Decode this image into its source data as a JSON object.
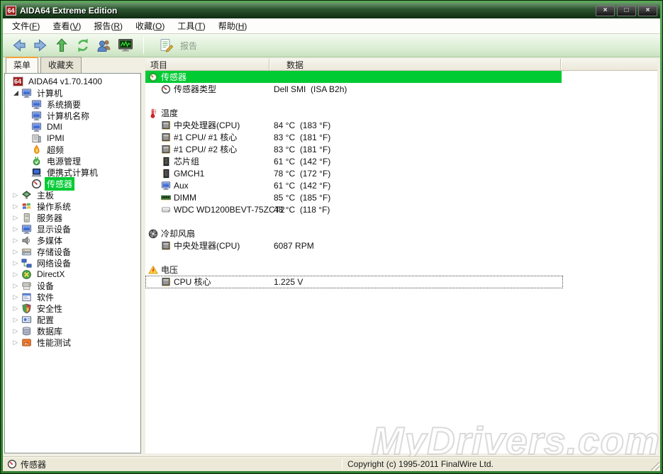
{
  "window": {
    "title": "AIDA64 Extreme Edition",
    "logo_text": "64",
    "buttons": [
      {
        "name": "minimize",
        "glyph": "×"
      },
      {
        "name": "maximize",
        "glyph": "□"
      },
      {
        "name": "close",
        "glyph": "×"
      }
    ]
  },
  "menu": {
    "items": [
      "文件(F)",
      "查看(V)",
      "报告(R)",
      "收藏(O)",
      "工具(T)",
      "帮助(H)"
    ]
  },
  "toolbar": {
    "buttons": [
      {
        "name": "back",
        "icon": "back"
      },
      {
        "name": "forward",
        "icon": "forward"
      },
      {
        "name": "up",
        "icon": "up"
      },
      {
        "name": "refresh",
        "icon": "refresh"
      },
      {
        "name": "users",
        "icon": "users"
      },
      {
        "name": "sensor-panel",
        "icon": "monitorgraph"
      }
    ],
    "report_label": "报告"
  },
  "sidebar": {
    "tabs": [
      {
        "label": "菜单",
        "active": true
      },
      {
        "label": "收藏夹",
        "active": false
      }
    ],
    "tree": [
      {
        "level": 0,
        "arrow": "",
        "icon": "aida64",
        "label": "AIDA64 v1.70.1400"
      },
      {
        "level": 0,
        "arrow": "expanded",
        "icon": "computer",
        "label": "计算机"
      },
      {
        "level": 1,
        "arrow": "",
        "icon": "computer",
        "label": "系统摘要"
      },
      {
        "level": 1,
        "arrow": "",
        "icon": "computer",
        "label": "计算机名称"
      },
      {
        "level": 1,
        "arrow": "",
        "icon": "computer",
        "label": "DMI"
      },
      {
        "level": 1,
        "arrow": "",
        "icon": "board",
        "label": "IPMI"
      },
      {
        "level": 1,
        "arrow": "",
        "icon": "flame",
        "label": "超频"
      },
      {
        "level": 1,
        "arrow": "",
        "icon": "plug",
        "label": "电源管理"
      },
      {
        "level": 1,
        "arrow": "",
        "icon": "laptop",
        "label": "便携式计算机"
      },
      {
        "level": 1,
        "arrow": "",
        "icon": "gauge",
        "label": "传感器",
        "selected": true
      },
      {
        "level": 0,
        "arrow": "collapsed",
        "icon": "motherboard",
        "label": "主板"
      },
      {
        "level": 0,
        "arrow": "collapsed",
        "icon": "windows",
        "label": "操作系统"
      },
      {
        "level": 0,
        "arrow": "collapsed",
        "icon": "server",
        "label": "服务器"
      },
      {
        "level": 0,
        "arrow": "collapsed",
        "icon": "display",
        "label": "显示设备"
      },
      {
        "level": 0,
        "arrow": "collapsed",
        "icon": "speaker",
        "label": "多媒体"
      },
      {
        "level": 0,
        "arrow": "collapsed",
        "icon": "storage",
        "label": "存储设备"
      },
      {
        "level": 0,
        "arrow": "collapsed",
        "icon": "network",
        "label": "网络设备"
      },
      {
        "level": 0,
        "arrow": "collapsed",
        "icon": "directx",
        "label": "DirectX"
      },
      {
        "level": 0,
        "arrow": "collapsed",
        "icon": "devices",
        "label": "设备"
      },
      {
        "level": 0,
        "arrow": "collapsed",
        "icon": "software",
        "label": "软件"
      },
      {
        "level": 0,
        "arrow": "collapsed",
        "icon": "shield",
        "label": "安全性"
      },
      {
        "level": 0,
        "arrow": "collapsed",
        "icon": "config",
        "label": "配置"
      },
      {
        "level": 0,
        "arrow": "collapsed",
        "icon": "database",
        "label": "数据库"
      },
      {
        "level": 0,
        "arrow": "collapsed",
        "icon": "benchmark",
        "label": "性能测试"
      }
    ]
  },
  "main": {
    "columns": [
      "项目",
      "数据"
    ],
    "rows": [
      {
        "type": "group",
        "icon": "gaugegreen",
        "label": "传感器"
      },
      {
        "type": "item",
        "icon": "gauge",
        "label": "传感器类型",
        "value": "Dell SMI  (ISA B2h)"
      },
      {
        "type": "spacer"
      },
      {
        "type": "section",
        "icon": "thermometer",
        "label": "温度"
      },
      {
        "type": "item",
        "icon": "chip",
        "label": "中央处理器(CPU)",
        "value": "84 °C  (183 °F)"
      },
      {
        "type": "item",
        "icon": "chip",
        "label": "#1 CPU/ #1 核心",
        "value": "83 °C  (181 °F)"
      },
      {
        "type": "item",
        "icon": "chip",
        "label": "#1 CPU/ #2 核心",
        "value": "83 °C  (181 °F)"
      },
      {
        "type": "item",
        "icon": "chipset",
        "label": "芯片组",
        "value": "61 °C  (142 °F)"
      },
      {
        "type": "item",
        "icon": "chipset",
        "label": "GMCH1",
        "value": "78 °C  (172 °F)"
      },
      {
        "type": "item",
        "icon": "computer",
        "label": "Aux",
        "value": "61 °C  (142 °F)"
      },
      {
        "type": "item",
        "icon": "ram",
        "label": "DIMM",
        "value": "85 °C  (185 °F)"
      },
      {
        "type": "item",
        "icon": "hdd",
        "label": "WDC WD1200BEVT-75ZCT2",
        "value": "48 °C  (118 °F)"
      },
      {
        "type": "spacer"
      },
      {
        "type": "section",
        "icon": "fan",
        "label": "冷却风扇"
      },
      {
        "type": "item",
        "icon": "chip",
        "label": "中央处理器(CPU)",
        "value": "6087 RPM"
      },
      {
        "type": "spacer"
      },
      {
        "type": "section",
        "icon": "voltage",
        "label": "电压"
      },
      {
        "type": "item",
        "icon": "chip",
        "label": "CPU 核心",
        "value": "1.225 V",
        "focused": true
      }
    ]
  },
  "statusbar": {
    "left": "传感器",
    "right": "Copyright (c) 1995-2011 FinalWire Ltd."
  },
  "watermark": "MyDrivers.com",
  "colors": {
    "selection_green": "#00cb33",
    "titlebar_green": "#1d3b1f",
    "tab_accent_orange": "#f0a23c",
    "frame_green": "#2e7d2e"
  }
}
